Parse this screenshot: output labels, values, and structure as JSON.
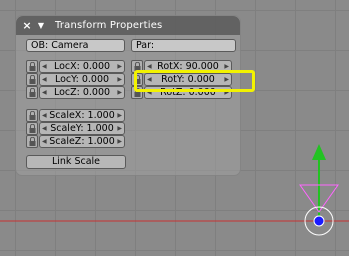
{
  "panel": {
    "title": "Transform Properties",
    "close_icon": "×",
    "collapse_icon": "▼"
  },
  "object_field": {
    "value": "OB: Camera"
  },
  "parent_field": {
    "value": "Par:"
  },
  "location": [
    {
      "label": "LocX: 0.000"
    },
    {
      "label": "LocY: 0.000"
    },
    {
      "label": "LocZ: 0.000"
    }
  ],
  "rotation": [
    {
      "label": "RotX: 90.000"
    },
    {
      "label": "RotY: 0.000"
    },
    {
      "label": "RotZ: 0.000"
    }
  ],
  "scale": [
    {
      "label": "ScaleX: 1.000"
    },
    {
      "label": "ScaleY: 1.000"
    },
    {
      "label": "ScaleZ: 1.000"
    }
  ],
  "link_scale": {
    "label": "Link Scale"
  },
  "colors": {
    "highlight": "#f2f200",
    "x_axis": "#c83232",
    "z_axis": "#22c322",
    "camera": "#ff66ff",
    "origin": "#1a1aff"
  }
}
